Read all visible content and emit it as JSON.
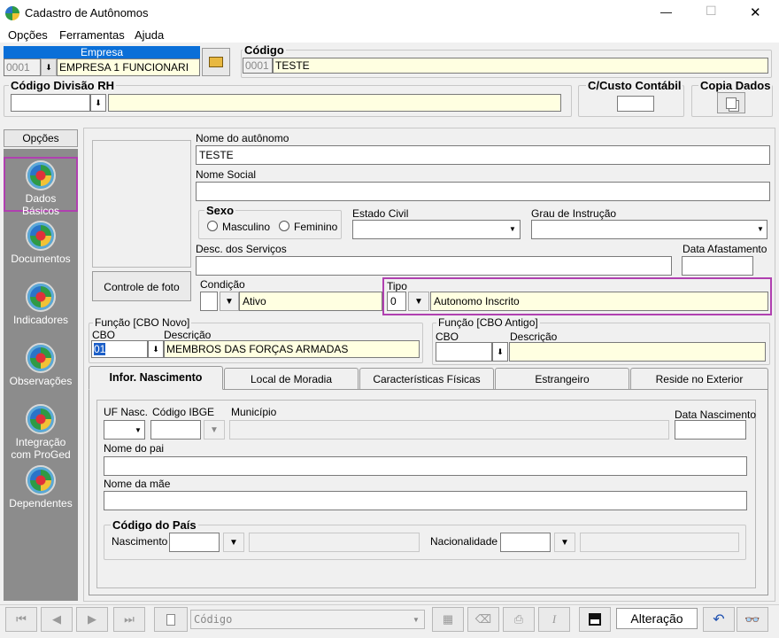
{
  "window": {
    "title": "Cadastro de Autônomos",
    "min": "—",
    "max": "☐",
    "close": "✕"
  },
  "menu": [
    "Opções",
    "Ferramentas",
    "Ajuda"
  ],
  "empresa": {
    "label": "Empresa",
    "code": "0001",
    "name": "EMPRESA 1 FUNCIONARI"
  },
  "codigo": {
    "label": "Código",
    "code": "0001",
    "name": "TESTE"
  },
  "divisao": {
    "label": "Código Divisão RH",
    "code": "",
    "name": ""
  },
  "custo": {
    "label": "C/Custo Contábil",
    "value": ""
  },
  "copia": {
    "label": "Copia Dados"
  },
  "sidebar": {
    "title": "Opções",
    "items": [
      {
        "label": "Dados Básicos"
      },
      {
        "label": "Documentos"
      },
      {
        "label": "Indicadores"
      },
      {
        "label": "Observações"
      },
      {
        "label": "Integração com ProGed"
      },
      {
        "label": "Dependentes"
      }
    ]
  },
  "foto": {
    "button": "Controle de foto"
  },
  "nome": {
    "label": "Nome do autônomo",
    "value": "TESTE"
  },
  "nome_social": {
    "label": "Nome Social",
    "value": ""
  },
  "sexo": {
    "label": "Sexo",
    "masculino": "Masculino",
    "feminino": "Feminino"
  },
  "estado_civil": {
    "label": "Estado Civil",
    "value": ""
  },
  "grau": {
    "label": "Grau de Instrução",
    "value": ""
  },
  "desc_servicos": {
    "label": "Desc. dos Serviços",
    "value": ""
  },
  "data_afast": {
    "label": "Data Afastamento",
    "value": ""
  },
  "condicao": {
    "label": "Condição",
    "code": "",
    "value": "Ativo"
  },
  "tipo": {
    "label": "Tipo",
    "code": "0",
    "value": "Autonomo Inscrito"
  },
  "funcao_novo": {
    "label": "Função [CBO Novo]",
    "cbo_label": "CBO",
    "desc_label": "Descrição",
    "cbo": "01",
    "desc": "MEMBROS DAS FORÇAS ARMADAS"
  },
  "funcao_antigo": {
    "label": "Função [CBO Antigo]",
    "cbo_label": "CBO",
    "desc_label": "Descrição",
    "cbo": "",
    "desc": ""
  },
  "tabs": [
    "Infor. Nascimento",
    "Local de Moradia",
    "Características Físicas",
    "Estrangeiro",
    "Reside no Exterior"
  ],
  "nasc": {
    "uf_label": "UF Nasc.",
    "ibge_label": "Código IBGE",
    "municipio_label": "Município",
    "data_label": "Data Nascimento",
    "pai_label": "Nome do pai",
    "mae_label": "Nome da mãe",
    "pais_label": "Código do País",
    "nascimento_label": "Nascimento",
    "nacionalidade_label": "Nacionalidade"
  },
  "bottom": {
    "codigo_placeholder": "Código",
    "status": "Alteração"
  },
  "colors": {
    "sidebar_bg": "#8c8c8c",
    "highlight_border": "#a040a0",
    "field_yellow": "#ffffe1",
    "empresa_header": "#0a6fd8"
  }
}
